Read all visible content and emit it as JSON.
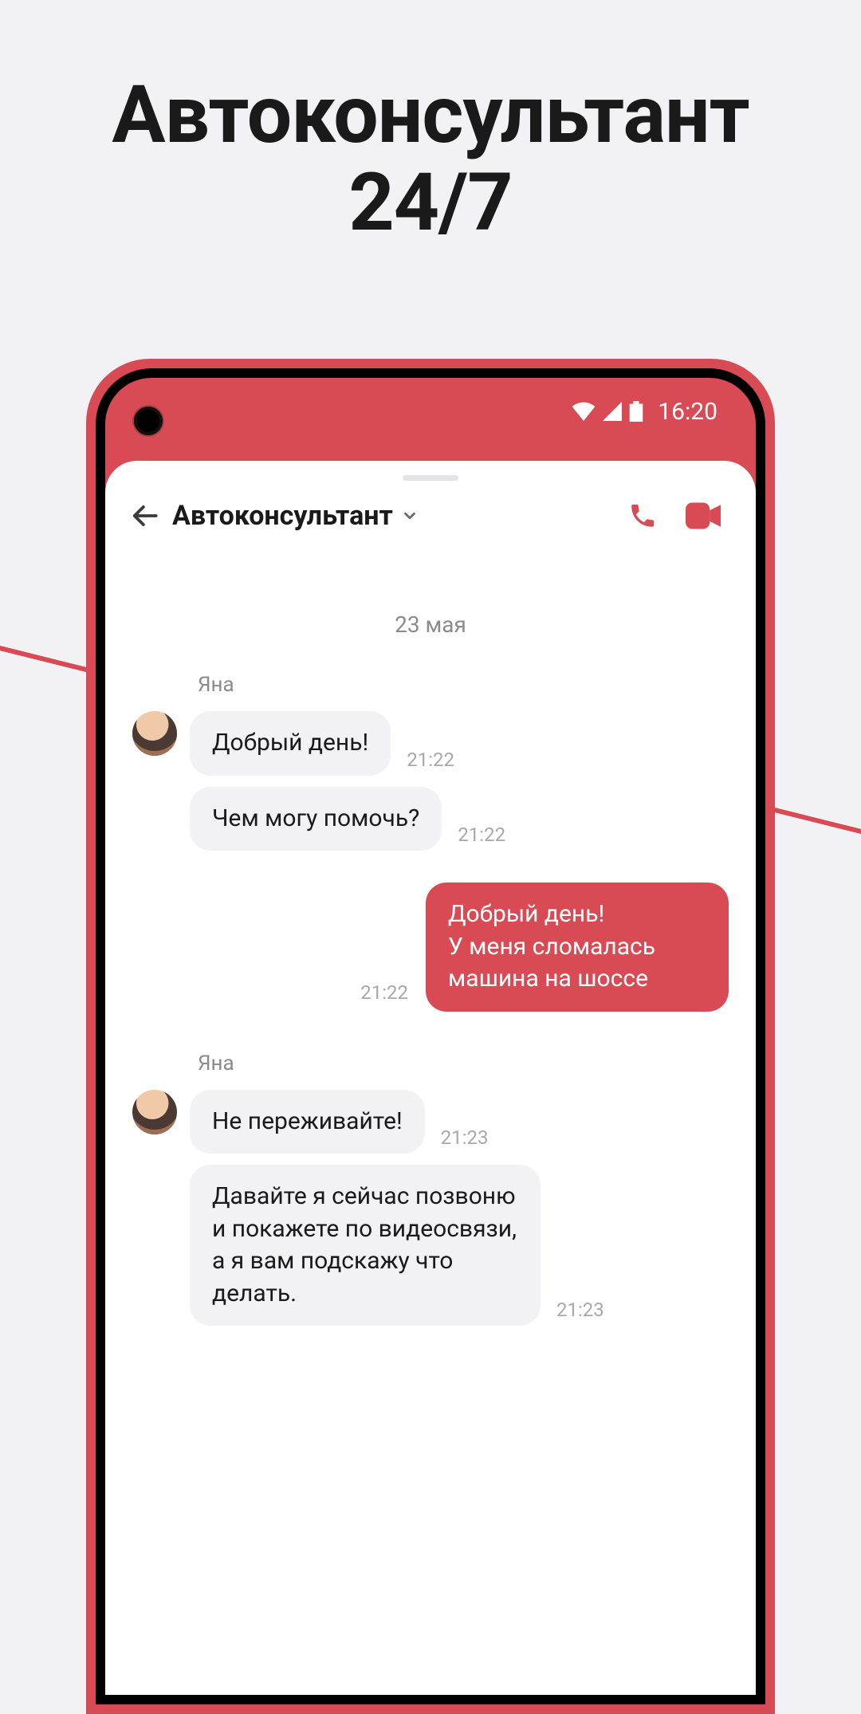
{
  "promo": {
    "title": "Автоконсультант\n24/7"
  },
  "status": {
    "time": "16:20"
  },
  "header": {
    "title": "Автоконсультант"
  },
  "chat": {
    "date": "23 мая",
    "groups": [
      {
        "type": "in",
        "sender": "Яна",
        "messages": [
          {
            "text": "Добрый день!",
            "time": "21:22"
          },
          {
            "text": "Чем могу помочь?",
            "time": "21:22"
          }
        ]
      },
      {
        "type": "out",
        "messages": [
          {
            "text": "Добрый день!\nУ меня сломалась машина на шоссе",
            "time": "21:22"
          }
        ]
      },
      {
        "type": "in",
        "sender": "Яна",
        "messages": [
          {
            "text": "Не переживайте!",
            "time": "21:23"
          },
          {
            "text": "Давайте я сейчас позвоню и покажете по видеосвязи, а я вам подскажу что делать.",
            "time": "21:23"
          }
        ]
      }
    ]
  }
}
